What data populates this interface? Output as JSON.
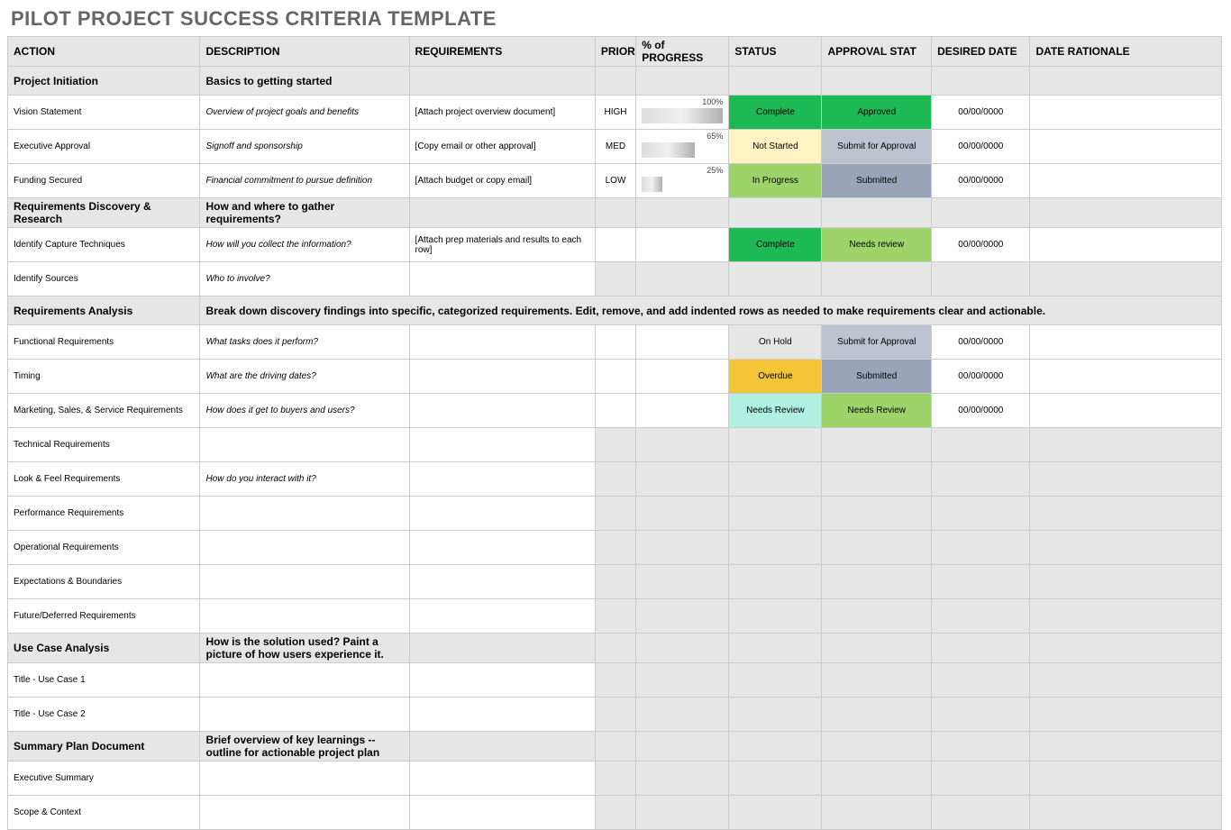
{
  "title": "PILOT PROJECT SUCCESS CRITERIA TEMPLATE",
  "columns": [
    "ACTION",
    "DESCRIPTION",
    "REQUIREMENTS",
    "PRIORITY",
    "% of PROGRESS",
    "STATUS",
    "APPROVAL STAT",
    "DESIRED DATE",
    "DATE RATIONALE"
  ],
  "status_colors": {
    "Complete": "#1db954",
    "Not Started": "#fff3c4",
    "In Progress": "#9ed36a",
    "On Hold": "#e6e6e6",
    "Overdue": "#f5c436",
    "Needs Review": "#b0f0e0"
  },
  "approval_colors": {
    "Approved": "#1db954",
    "Submit for Approval": "#bcc3cf",
    "Submitted": "#9aa4b8",
    "Needs review": "#9ed36a",
    "Needs Review": "#9ed36a"
  },
  "rows": [
    {
      "type": "section",
      "action": "Project Initiation",
      "desc": "Basics to getting started"
    },
    {
      "type": "data",
      "action": "Vision Statement",
      "desc": "Overview of project goals and benefits",
      "req": "[Attach project overview document]",
      "priority": "HIGH",
      "progress": 100,
      "status": "Complete",
      "approval": "Approved",
      "date": "00/00/0000"
    },
    {
      "type": "data",
      "action": "Executive Approval",
      "desc": "Signoff and sponsorship",
      "req": "[Copy email or other approval]",
      "priority": "MED",
      "progress": 65,
      "status": "Not Started",
      "approval": "Submit for Approval",
      "date": "00/00/0000"
    },
    {
      "type": "data",
      "action": "Funding Secured",
      "desc": "Financial commitment to pursue definition",
      "req": "[Attach budget or copy email]",
      "priority": "LOW",
      "progress": 25,
      "status": "In Progress",
      "approval": "Submitted",
      "date": "00/00/0000"
    },
    {
      "type": "section",
      "action": "Requirements Discovery & Research",
      "desc": "How and where to gather requirements?"
    },
    {
      "type": "data",
      "action": "Identify Capture Techniques",
      "desc": "How will you collect the information?",
      "req": "[Attach prep materials and results to each row]",
      "status": "Complete",
      "approval": "Needs review",
      "date": "00/00/0000"
    },
    {
      "type": "data",
      "action": "Identify Sources",
      "desc": "Who to involve?",
      "gray_tail": true
    },
    {
      "type": "section",
      "action": "Requirements Analysis",
      "desc_span": "Break down discovery findings into specific, categorized requirements. Edit, remove, and add indented rows as needed to make requirements clear and actionable."
    },
    {
      "type": "data",
      "action": "Functional Requirements",
      "desc": "What tasks does it perform?",
      "status": "On Hold",
      "approval": "Submit for Approval",
      "date": "00/00/0000"
    },
    {
      "type": "data",
      "action": "Timing",
      "desc": "What are the driving dates?",
      "status": "Overdue",
      "approval": "Submitted",
      "date": "00/00/0000"
    },
    {
      "type": "data",
      "action": "Marketing, Sales, & Service Requirements",
      "desc": "How does it get to buyers and users?",
      "status": "Needs Review",
      "approval": "Needs Review",
      "date": "00/00/0000"
    },
    {
      "type": "data",
      "action": "Technical Requirements",
      "gray_tail": true
    },
    {
      "type": "data",
      "action": "Look & Feel Requirements",
      "desc": "How do you interact with it?",
      "gray_tail": true
    },
    {
      "type": "data",
      "action": "Performance Requirements",
      "gray_tail": true
    },
    {
      "type": "data",
      "action": "Operational Requirements",
      "gray_tail": true
    },
    {
      "type": "data",
      "action": "Expectations & Boundaries",
      "gray_tail": true
    },
    {
      "type": "data",
      "action": "Future/Deferred Requirements",
      "gray_tail": true
    },
    {
      "type": "section",
      "action": "Use Case Analysis",
      "desc": "How is the solution used? Paint a picture of how users experience it."
    },
    {
      "type": "data",
      "action": "Title - Use Case 1",
      "gray_tail": true
    },
    {
      "type": "data",
      "action": "Title - Use Case 2",
      "gray_tail": true
    },
    {
      "type": "section",
      "action": "Summary Plan Document",
      "desc": "Brief overview of key learnings -- outline for actionable project plan"
    },
    {
      "type": "data",
      "action": "Executive Summary",
      "gray_tail": true
    },
    {
      "type": "data",
      "action": "Scope & Context",
      "gray_tail": true
    }
  ]
}
